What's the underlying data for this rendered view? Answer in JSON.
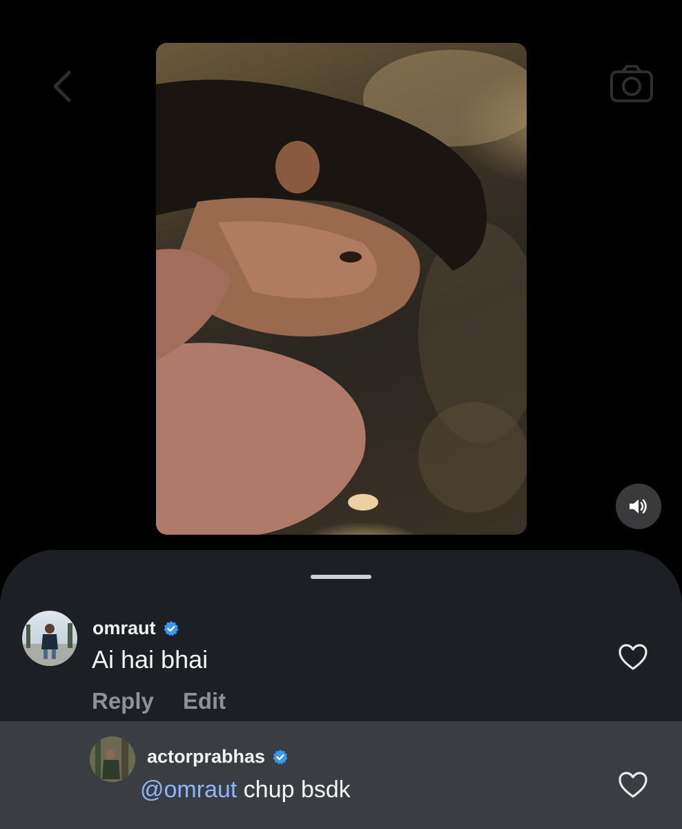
{
  "comment": {
    "username": "omraut",
    "text": "Ai hai bhai",
    "actions": {
      "reply": "Reply",
      "edit": "Edit"
    }
  },
  "reply": {
    "username": "actorprabhas",
    "mention": "@omraut",
    "text": "chup bsdk"
  },
  "icons": {
    "verified_color": "#3897f0",
    "sheet_background": "#1c1f24",
    "reply_highlight": "#3a3d42",
    "mention_color": "#8fb4ff"
  }
}
